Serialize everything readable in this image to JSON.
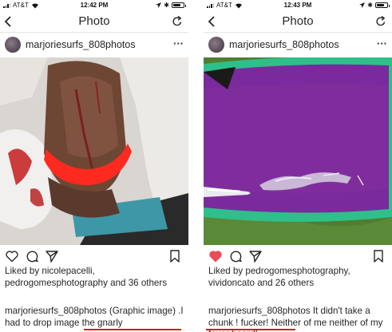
{
  "colors": {
    "like_red": "#ed4956",
    "annotation_red": "#e0161b",
    "grass": "#4d7a2e",
    "board_purple": "#7a2a9c",
    "board_rail": "#2fbf8a"
  },
  "panels": [
    {
      "status": {
        "carrier": "AT&T",
        "time": "12:42 PM"
      },
      "nav": {
        "title": "Photo"
      },
      "post": {
        "username": "marjoriesurfs_808photos",
        "more_label": "···",
        "liked": false,
        "likes_text": "Liked by nicolepacelli, pedrogomesphotography and 36 others",
        "caption_user": "marjoriesurfs_808photos",
        "caption_text": " (Graphic image) .I had to drop image the gnarly"
      }
    },
    {
      "status": {
        "carrier": "AT&T",
        "time": "12:43 PM"
      },
      "nav": {
        "title": "Photo"
      },
      "post": {
        "username": "marjoriesurfs_808photos",
        "more_label": "···",
        "liked": true,
        "likes_text": "Liked by pedrogomesphotography, vividoncato and 26 others",
        "caption_user": "marjoriesurfs_808photos",
        "caption_text": " It didn't take a chunk ! fucker! Neither of me neither of my favor board!"
      }
    }
  ]
}
